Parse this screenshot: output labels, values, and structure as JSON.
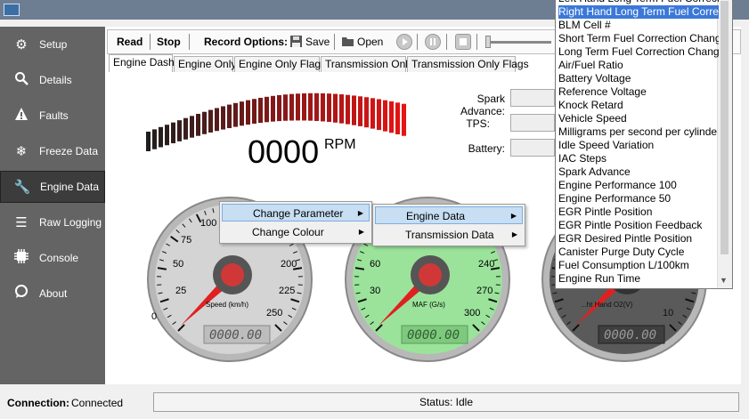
{
  "sidebar": {
    "items": [
      {
        "label": "Setup",
        "icon": "gears-icon"
      },
      {
        "label": "Details",
        "icon": "search-icon"
      },
      {
        "label": "Faults",
        "icon": "warning-icon"
      },
      {
        "label": "Freeze Data",
        "icon": "snowflake-icon"
      },
      {
        "label": "Engine Data",
        "icon": "wrench-icon"
      },
      {
        "label": "Raw Logging",
        "icon": "menu-lines-icon"
      },
      {
        "label": "Console",
        "icon": "chip-icon"
      },
      {
        "label": "About",
        "icon": "chat-icon"
      }
    ],
    "active": "Engine Data"
  },
  "toolbar": {
    "read": "Read",
    "stop": "Stop",
    "record_options": "Record Options:",
    "save": "Save",
    "open": "Open"
  },
  "tabs": [
    "Engine Dash",
    "Engine Only",
    "Engine Only Flags",
    "Transmission Only",
    "Transmission Only Flags"
  ],
  "rpm": {
    "value": "0000",
    "unit": "RPM"
  },
  "fields": {
    "spark_advance": "Spark Advance:",
    "tps": "TPS:",
    "battery": "Battery:"
  },
  "gauges": {
    "speed": {
      "label": "Speed (km/h)",
      "ticks": [
        "0",
        "25",
        "50",
        "75",
        "100",
        "200",
        "225",
        "250"
      ],
      "lcd": "0000.00",
      "value": 0,
      "face": "#d4d4d4"
    },
    "maf": {
      "label": "MAF (G/s)",
      "ticks": [
        "30",
        "60",
        "240",
        "270",
        "300"
      ],
      "lcd": "0000.00",
      "value": 0,
      "face": "#9be39b"
    },
    "o2": {
      "label": "...ht Hand O2(V)",
      "ticks": [
        "10"
      ],
      "lcd": "0000.00",
      "value": 0,
      "face": "#5a5a5a"
    }
  },
  "context_menu": {
    "items": [
      "Change Parameter",
      "Change Colour"
    ],
    "submenu": [
      "Engine Data",
      "Transmission Data"
    ]
  },
  "dropdown": {
    "items": [
      "Left Hand Long Term Fuel Correct",
      "Right Hand Long Term Fuel Corre",
      "BLM Cell #",
      "Short Term Fuel Correction Chang",
      "Long Term Fuel Correction Chang",
      "Air/Fuel Ratio",
      "Battery Voltage",
      "Reference Voltage",
      "Knock Retard",
      "Vehicle Speed",
      "Milligrams per second per cylinde",
      "Idle Speed Variation",
      "IAC Steps",
      "Spark Advance",
      "Engine Performance 100",
      "Engine Performance 50",
      "EGR Pintle Position",
      "EGR Pintle Position Feedback",
      "EGR Desired Pintle Position",
      "Canister Purge Duty Cycle",
      "Fuel Consumption L/100km",
      "Engine Run Time"
    ],
    "selected_index": 1
  },
  "status": {
    "connection_label": "Connection:",
    "connection_value": "Connected",
    "status_text": "Status: Idle"
  },
  "colors": {
    "accent": "#3b78d8",
    "sidebar": "#646464",
    "needle": "#e02020",
    "rpm_high": "#e02020"
  }
}
